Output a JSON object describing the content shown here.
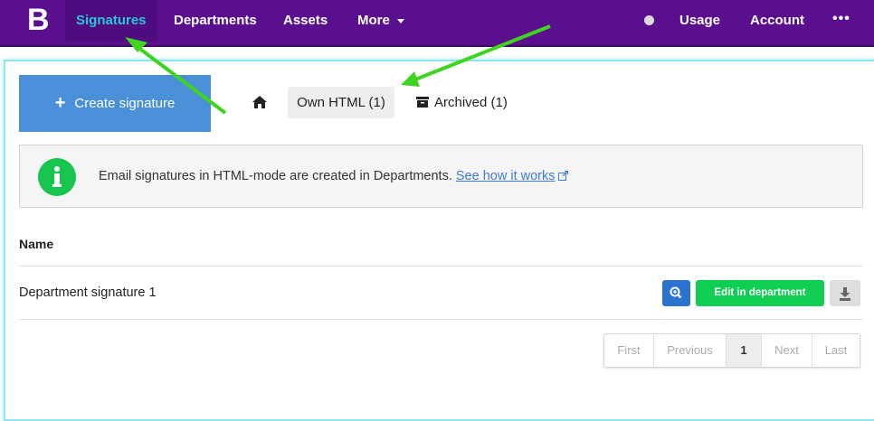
{
  "topbar": {
    "logo": "B",
    "nav": [
      "Signatures",
      "Departments",
      "Assets",
      "More"
    ],
    "right": [
      "Usage",
      "Account"
    ],
    "more_dots": "•••"
  },
  "toolbar": {
    "create_label": "Create signature",
    "tab_own": "Own HTML (1)",
    "tab_archived": "Archived (1)"
  },
  "info": {
    "text": "Email signatures in HTML-mode are created in Departments.",
    "link": "See how it works"
  },
  "table": {
    "header": "Name",
    "rows": [
      {
        "name": "Department signature 1",
        "edit_label": "Edit in department"
      }
    ]
  },
  "pagination": {
    "first": "First",
    "previous": "Previous",
    "current": "1",
    "next": "Next",
    "last": "Last"
  },
  "colors": {
    "topbar": "#5a0f8f",
    "active_nav": "#27c8d8",
    "create_button": "#4a90d9",
    "edit_button": "#0fce52",
    "info_icon": "#17c54e",
    "annotation_arrow": "#3fd41f"
  },
  "icons": [
    "home-icon",
    "archive-icon",
    "info-icon",
    "external-link-icon",
    "zoom-icon",
    "download-icon"
  ]
}
